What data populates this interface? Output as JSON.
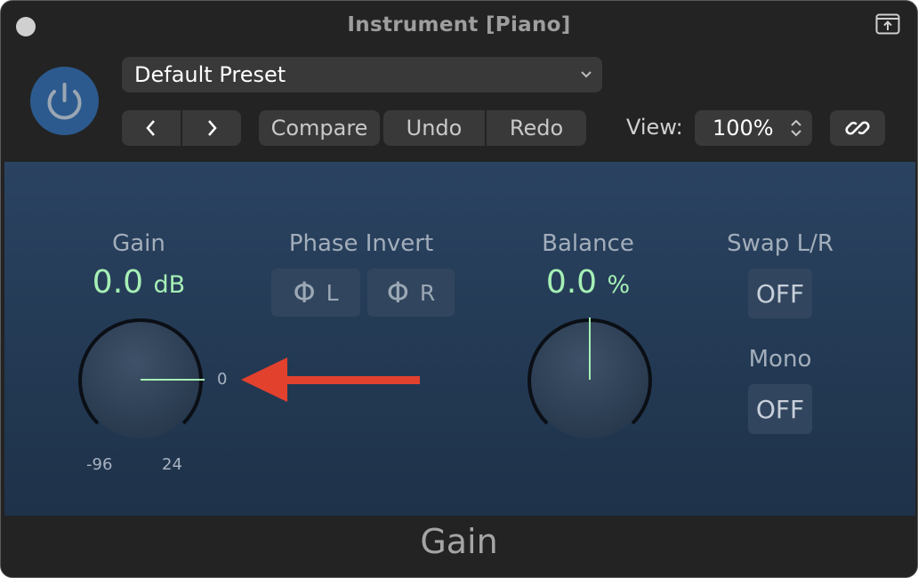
{
  "window": {
    "title": "Instrument [Piano]"
  },
  "header": {
    "preset": "Default Preset",
    "nav_prev": "‹",
    "nav_next": "›",
    "compare": "Compare",
    "undo": "Undo",
    "redo": "Redo",
    "view_label": "View:",
    "zoom": "100%"
  },
  "controls": {
    "gain": {
      "label": "Gain",
      "value": "0.0",
      "unit": "dB",
      "min_label": "-96",
      "max_label": "24",
      "zero_label": "0"
    },
    "phase_invert": {
      "label": "Phase Invert",
      "left": "L",
      "right": "R",
      "phi": "Φ"
    },
    "balance": {
      "label": "Balance",
      "value": "0.0",
      "unit": "%"
    },
    "swap": {
      "label": "Swap L/R",
      "state": "OFF"
    },
    "mono": {
      "label": "Mono",
      "state": "OFF"
    }
  },
  "footer": {
    "label": "Gain"
  },
  "colors": {
    "accent_green": "#a6f0b5",
    "panel_blue": "#2a4361",
    "power_blue": "#2c5a8e",
    "arrow_red": "#e2412e"
  }
}
